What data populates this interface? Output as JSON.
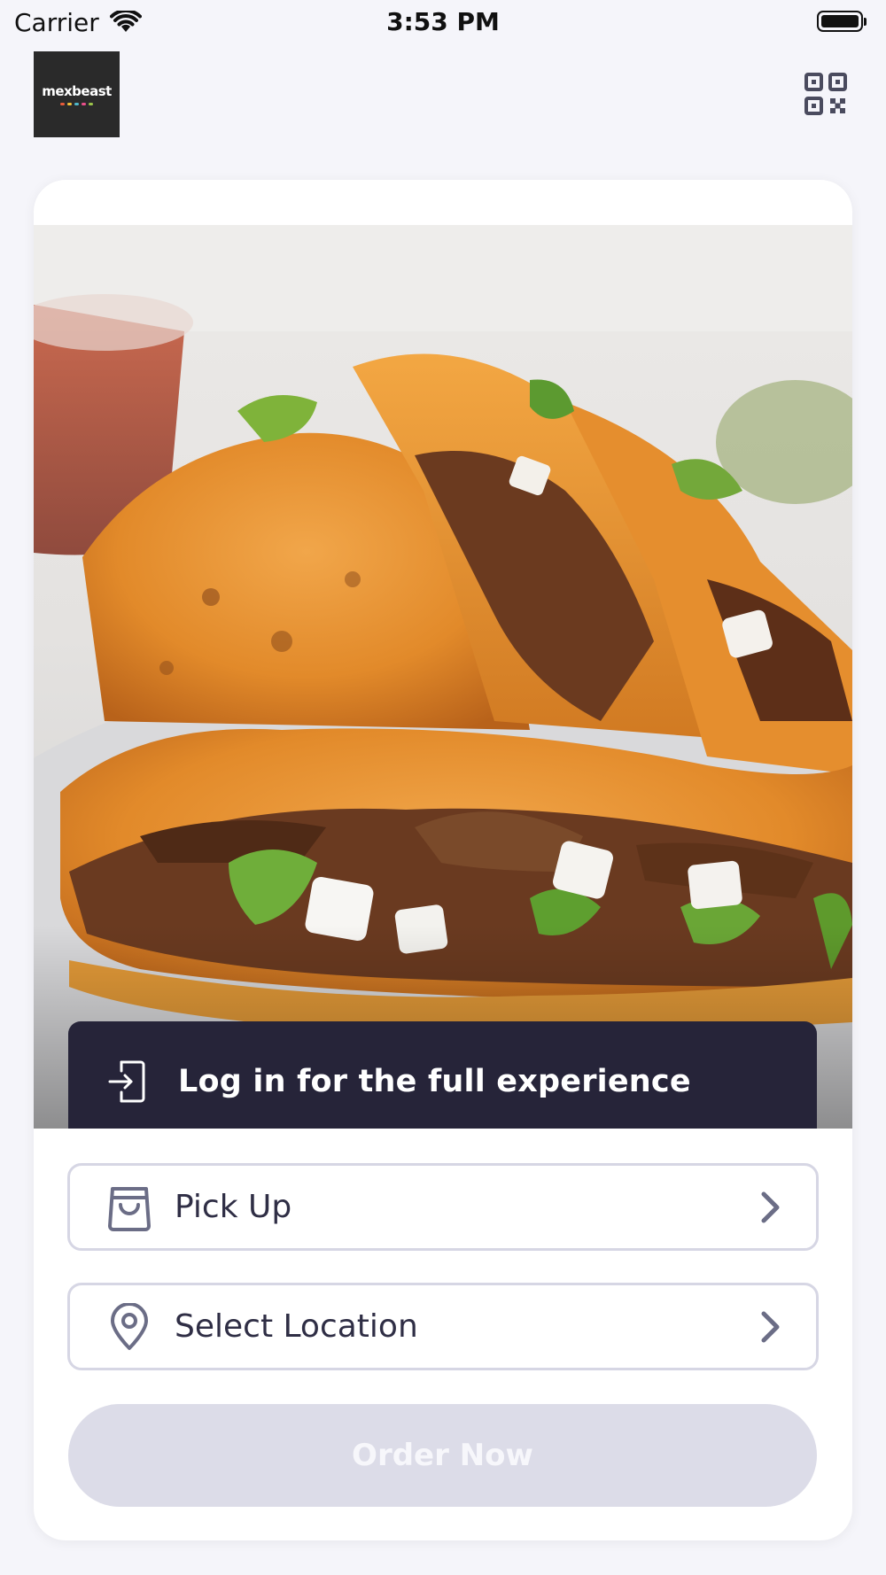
{
  "status_bar": {
    "carrier": "Carrier",
    "time": "3:53 PM",
    "wifi_icon": "wifi-icon",
    "battery_icon": "battery-icon"
  },
  "header": {
    "logo_text": "mexbeast",
    "qr_icon": "qr-code-icon"
  },
  "hero": {
    "image": "tacos-photo",
    "login_banner": {
      "icon": "login-icon",
      "label": "Log in for the full experience"
    }
  },
  "options": {
    "pickup": {
      "icon": "shopping-bag-icon",
      "label": "Pick Up",
      "chevron": "chevron-right-icon"
    },
    "location": {
      "icon": "map-pin-icon",
      "label": "Select Location",
      "chevron": "chevron-right-icon"
    }
  },
  "order_button": {
    "label": "Order Now",
    "disabled": true
  },
  "colors": {
    "background": "#f5f5fa",
    "card": "#ffffff",
    "banner": "#262439",
    "border": "#d6d6e4",
    "disabled_button": "#dcdce8",
    "icon": "#6b6d86"
  }
}
